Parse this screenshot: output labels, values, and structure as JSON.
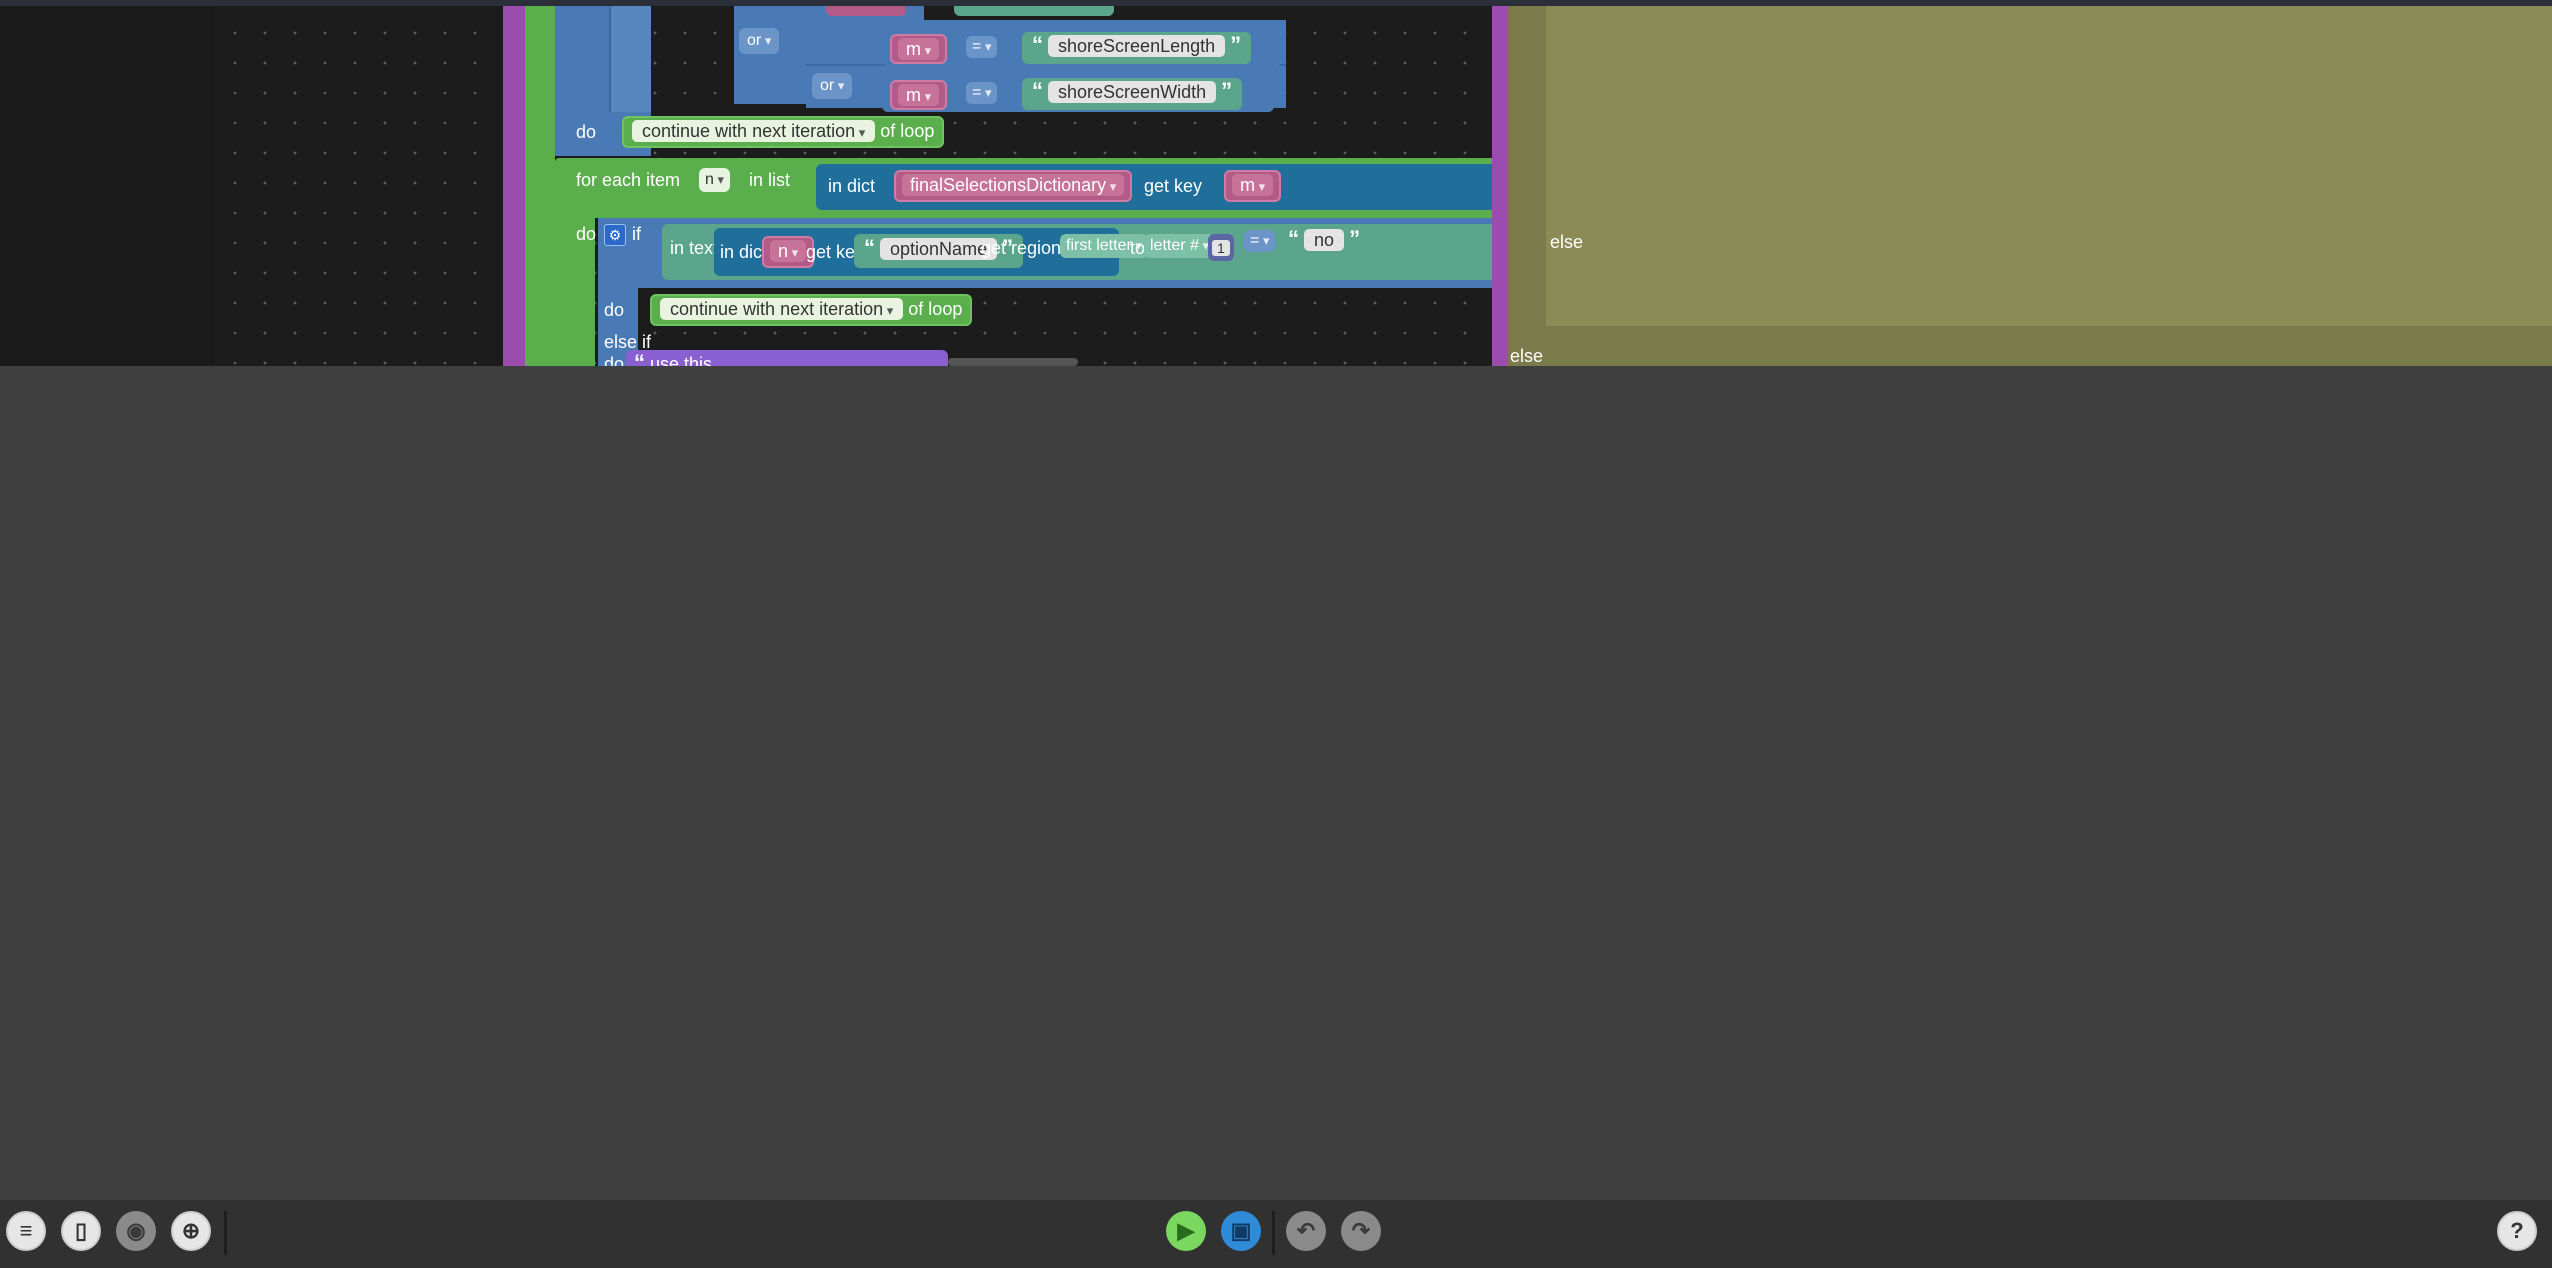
{
  "workspace": {
    "conditions": [
      {
        "connector": "or",
        "var": "m",
        "op": "=",
        "text": "shoreScreenLength"
      },
      {
        "connector": "or",
        "var": "m",
        "op": "=",
        "text": "shoreScreenWidth"
      }
    ],
    "do_label": "do",
    "continue_block": {
      "label": "continue with next iteration",
      "suffix": "of loop"
    },
    "for_each": {
      "prefix": "for each item",
      "var": "n",
      "mid": "in list"
    },
    "in_dict_block": {
      "prefix": "in dict",
      "dict": "finalSelectionsDictionary",
      "get_key": "get key",
      "key": "m"
    },
    "if_block": {
      "keyword": "if",
      "in_text": "in text",
      "in_dict": "in dict",
      "dict_var": "n",
      "get_key": "get key",
      "key_text": "optionName",
      "get_region": "get region from",
      "from": "first letter",
      "to": "to",
      "to_val": "letter #",
      "num": "1",
      "op": "=",
      "compare_text": "no"
    },
    "inner_do": "do",
    "inner_continue": {
      "label": "continue with next iteration",
      "suffix": "of loop"
    },
    "else_if": "else if",
    "do2": "do",
    "comment_text": "use this",
    "right_labels": {
      "else_top": "else",
      "else_bottom": "else"
    }
  },
  "toolbar": {
    "buttons": [
      "menu-icon",
      "panel-icon",
      "camera-icon",
      "target-icon",
      "play-icon",
      "save-icon",
      "undo-icon",
      "redo-icon",
      "help-icon"
    ],
    "help_label": "?"
  },
  "colors": {
    "canvas": "#1c1c1c",
    "background": "#3f3f3f",
    "loop_green": "#5aae4c",
    "control_blue": "#4a7ab5",
    "dict_blue": "#1f6f9a",
    "text_teal": "#5ba58c",
    "var_pink": "#b35a86",
    "proc_purple": "#9a4caf",
    "olive": "#7a7a4a"
  }
}
